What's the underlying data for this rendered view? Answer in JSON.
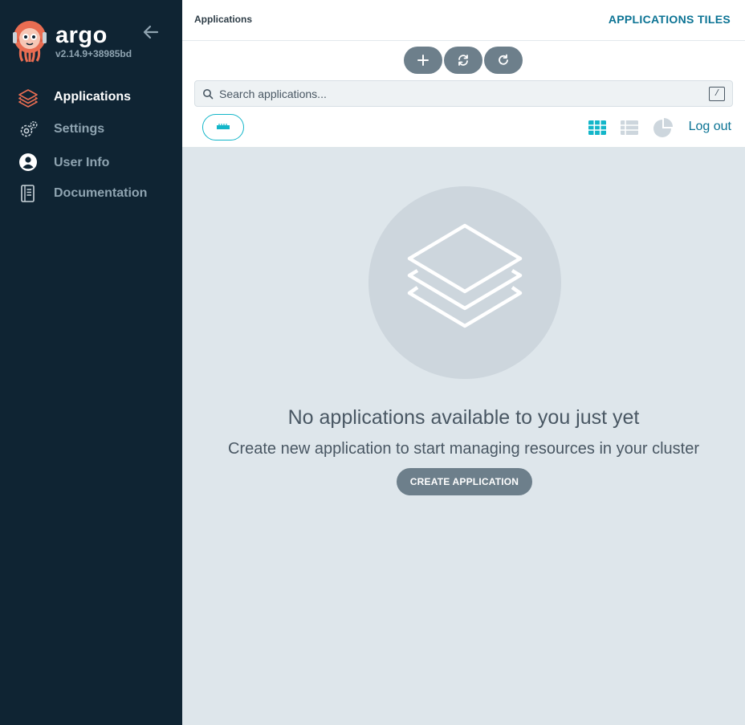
{
  "brand": {
    "name": "argo",
    "version": "v2.14.9+38985bd"
  },
  "sidebar": {
    "items": [
      {
        "label": "Applications",
        "icon": "layers-icon",
        "active": true
      },
      {
        "label": "Settings",
        "icon": "gears-icon",
        "active": false
      },
      {
        "label": "User Info",
        "icon": "user-circle-icon",
        "active": false
      },
      {
        "label": "Documentation",
        "icon": "book-icon",
        "active": false
      }
    ]
  },
  "header": {
    "breadcrumb": "Applications",
    "view_title": "APPLICATIONS TILES"
  },
  "toolbar": {
    "buttons": [
      "plus-icon",
      "sync-icon",
      "refresh-icon"
    ]
  },
  "search": {
    "placeholder": "Search applications...",
    "shortcut": "/"
  },
  "view_switcher": [
    "tiles-icon",
    "list-icon",
    "pie-chart-icon"
  ],
  "logout_label": "Log out",
  "empty_state": {
    "title": "No applications available to you just yet",
    "subtitle": "Create new application to start managing resources in your cluster",
    "button": "CREATE APPLICATION"
  },
  "colors": {
    "sidebar_bg": "#0f2433",
    "accent_teal": "#13b6c9",
    "link_blue": "#0b7394",
    "button_gray": "#6d7f8b",
    "active_icon": "#e96d52"
  }
}
